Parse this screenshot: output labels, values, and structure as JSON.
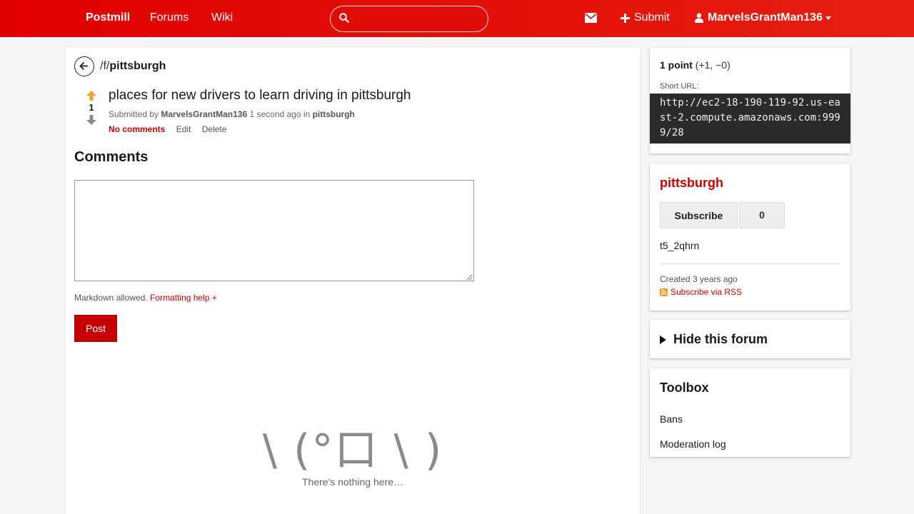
{
  "nav": {
    "brand": "Postmill",
    "links": [
      "Forums",
      "Wiki"
    ],
    "search_placeholder": "",
    "submit_label": "Submit",
    "username": "MarvelsGrantMan136"
  },
  "breadcrumb": {
    "prefix": "/f/",
    "forum": "pittsburgh"
  },
  "post": {
    "score": "1",
    "title": "places for new drivers to learn driving in pittsburgh",
    "submitted_by_prefix": "Submitted by",
    "author": "MarvelsGrantMan136",
    "time": "1 second ago",
    "in_word": "in",
    "forum": "pittsburgh",
    "comments_link": "No comments",
    "edit_label": "Edit",
    "delete_label": "Delete"
  },
  "comments": {
    "heading": "Comments",
    "textarea_value": "",
    "markdown_note": "Markdown allowed.",
    "formatting_help": "Formatting help +",
    "post_button": "Post",
    "empty_kaomoji": "\\ (°口 \\ )",
    "empty_text": "There's nothing here…"
  },
  "sidebar": {
    "points": {
      "bold": "1 point",
      "detail": "(+1, −0)"
    },
    "short_url_label": "Short URL:",
    "short_url": "http://ec2-18-190-119-92.us-east-2.compute.amazonaws.com:9999/28",
    "forum": {
      "name": "pittsburgh",
      "subscribe_label": "Subscribe",
      "subscriber_count": "0",
      "description": "t5_2qhrn",
      "created": "Created 3 years ago",
      "rss_label": "Subscribe via RSS"
    },
    "hide_forum_label": "Hide this forum",
    "toolbox": {
      "heading": "Toolbox",
      "links": [
        "Bans",
        "Moderation log"
      ]
    }
  },
  "colors": {
    "brand_red": "#e00000",
    "link_red": "#cc0000",
    "upvote_orange": "#f0a030"
  }
}
